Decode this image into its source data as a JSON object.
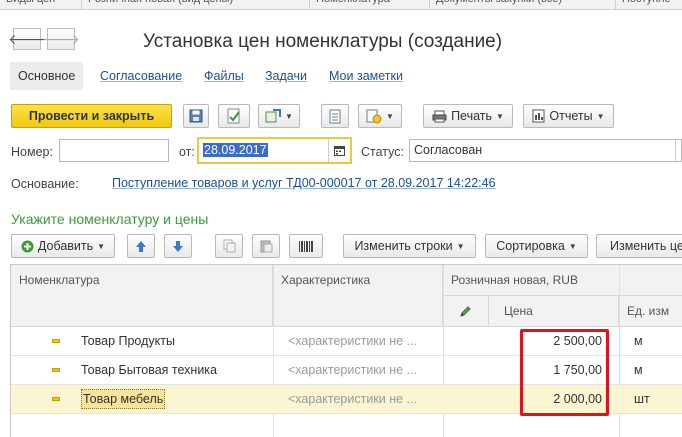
{
  "top_tabs": [
    "Виды цен",
    "Розничная новая (вид цены)",
    "Номенклатура",
    "Документы закупки (все)",
    "Поступле"
  ],
  "nav": {
    "back_glyph": "🡐",
    "forward_glyph": "🡒"
  },
  "window": {
    "title": "Установка цен номенклатуры (создание)"
  },
  "section_tabs": [
    {
      "label": "Основное"
    },
    {
      "label": "Согласование"
    },
    {
      "label": "Файлы"
    },
    {
      "label": "Задачи"
    },
    {
      "label": "Мои заметки"
    }
  ],
  "toolbar": {
    "post_close": "Провести и закрыть",
    "print": "Печать",
    "reports": "Отчеты"
  },
  "fields": {
    "number_label": "Номер:",
    "number_value": "",
    "date_label": "от:",
    "date_value": "28.09.2017",
    "status_label": "Статус:",
    "status_value": "Согласован",
    "basis_label": "Основание:",
    "basis_link": "Поступление товаров и услуг ТД00-000017 от 28.09.2017 14:22:46"
  },
  "section_heading": "Укажите номенклатуру и цены",
  "table_toolbar": {
    "add": "Добавить",
    "change_rows": "Изменить строки",
    "sort": "Сортировка",
    "change_cut": "Изменить це"
  },
  "table": {
    "headers": {
      "item": "Номенклатура",
      "characteristic": "Характеристика",
      "price_type": "Розничная новая, RUB",
      "price": "Цена",
      "unit": "Ед. изм"
    },
    "rows": [
      {
        "item": "Товар Продукты",
        "characteristic": "<характеристики не ...",
        "price": "2 500,00",
        "unit": "м"
      },
      {
        "item": "Товар Бытовая техника",
        "characteristic": "<характеристики не ...",
        "price": "1 750,00",
        "unit": "м"
      },
      {
        "item": "Товар мебель",
        "characteristic": "<характеристики не ...",
        "price": "2 000,00",
        "unit": "шт"
      }
    ],
    "selected_row": 3
  },
  "colors": {
    "primary_button": "#f0c80e",
    "link": "#1a4f9c",
    "heading_green": "#3b9c3b",
    "highlight_box": "#e0131a",
    "selected_row": "#fbf5d2"
  }
}
